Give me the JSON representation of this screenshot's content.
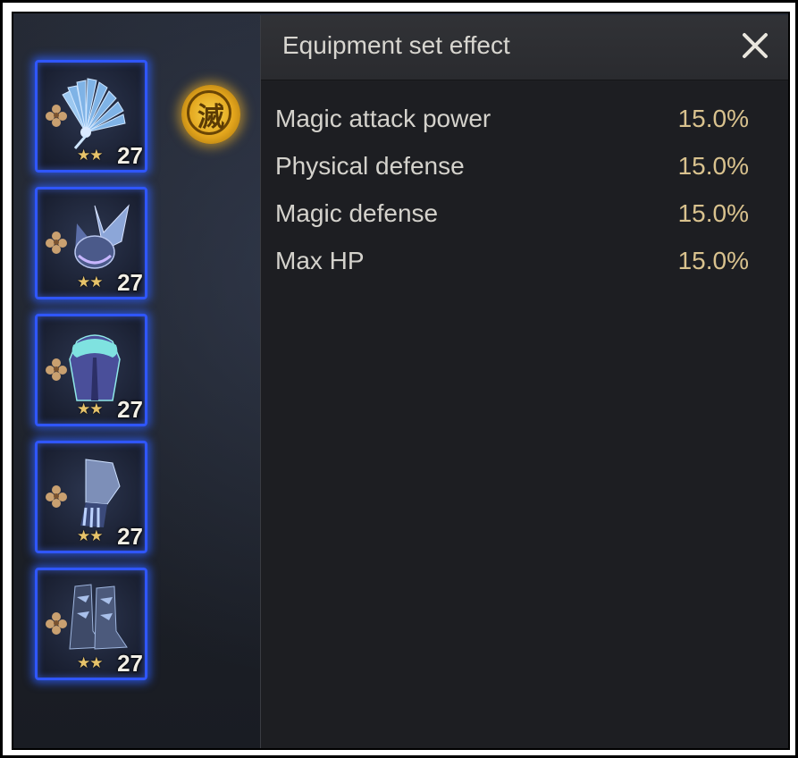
{
  "panel": {
    "title": "Equipment set effect",
    "close_icon": "close-icon"
  },
  "stats": [
    {
      "name": "Magic attack power",
      "value": "15.0%"
    },
    {
      "name": "Physical defense",
      "value": "15.0%"
    },
    {
      "name": "Magic defense",
      "value": "15.0%"
    },
    {
      "name": "Max HP",
      "value": "15.0%"
    }
  ],
  "equipment": [
    {
      "item": "feather-fan",
      "stars": "★★",
      "star_count": 2,
      "level": "27"
    },
    {
      "item": "winged-helmet",
      "stars": "★★",
      "star_count": 2,
      "level": "27"
    },
    {
      "item": "fur-armor",
      "stars": "★★",
      "star_count": 2,
      "level": "27"
    },
    {
      "item": "gauntlet",
      "stars": "★★",
      "star_count": 2,
      "level": "27"
    },
    {
      "item": "boots",
      "stars": "★★",
      "star_count": 2,
      "level": "27"
    }
  ],
  "seal": {
    "glyph": "滅"
  },
  "colors": {
    "slot_border": "#2f56ff",
    "stat_value": "#d9c28e",
    "seal_gold": "#e2a41c"
  }
}
